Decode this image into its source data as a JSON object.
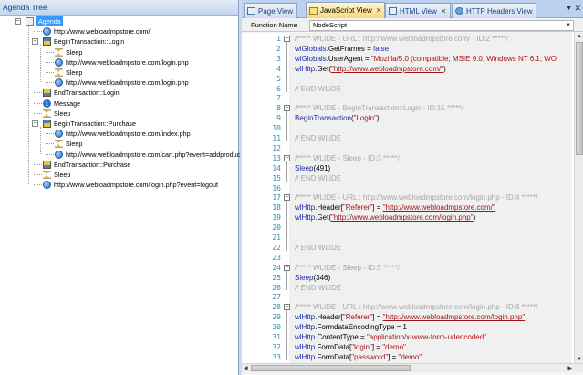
{
  "agenda_tree": {
    "title": "Agenda Tree",
    "items": [
      {
        "label": "Agenda",
        "icon": "agenda-icon",
        "level": 0,
        "selected": true
      },
      {
        "label": "http://www.webloadmpstore.com/",
        "icon": "globe-icon",
        "level": 1
      },
      {
        "label": "BeginTransaction::Login",
        "icon": "begin-transaction-icon",
        "level": 1
      },
      {
        "label": "Sleep",
        "icon": "hourglass-icon",
        "level": 2
      },
      {
        "label": "http://www.webloadmpstore.com/login.php",
        "icon": "globe-icon",
        "level": 2
      },
      {
        "label": "Sleep",
        "icon": "hourglass-icon",
        "level": 2
      },
      {
        "label": "http://www.webloadmpstore.com/login.php",
        "icon": "globe-icon",
        "level": 2
      },
      {
        "label": "EndTransaction::Login",
        "icon": "end-transaction-icon",
        "level": 1
      },
      {
        "label": "Message",
        "icon": "info-icon",
        "level": 1
      },
      {
        "label": "Sleep",
        "icon": "hourglass-icon",
        "level": 1
      },
      {
        "label": "BeginTransaction::Purchase",
        "icon": "begin-transaction-icon",
        "level": 1
      },
      {
        "label": "http://www.webloadmpstore.com/index.php",
        "icon": "globe-icon",
        "level": 2
      },
      {
        "label": "Sleep",
        "icon": "hourglass-icon",
        "level": 2
      },
      {
        "label": "http://www.webloadmpstore.com/cart.php?event=addproduc",
        "icon": "globe-icon",
        "level": 2
      },
      {
        "label": "EndTransaction::Purchase",
        "icon": "end-transaction-icon",
        "level": 1
      },
      {
        "label": "Sleep",
        "icon": "hourglass-icon",
        "level": 1
      },
      {
        "label": "http://www.webloadmpstore.com/login.php?event=logout",
        "icon": "globe-icon",
        "level": 1
      }
    ]
  },
  "tabs": [
    {
      "label": "Page View",
      "active": false
    },
    {
      "label": "JavaScript View",
      "active": true
    },
    {
      "label": "HTML View",
      "active": false
    },
    {
      "label": "HTTP Headers View",
      "active": false
    }
  ],
  "function_bar": {
    "label": "Function Name",
    "value": "NodeScript"
  },
  "editor": {
    "lines": [
      {
        "n": "1",
        "fold": "-",
        "parts": [
          {
            "t": "/***** WLIDE - URL : http://www.webloadmpstore.com/ - ID:2 *****/",
            "c": "comment"
          }
        ]
      },
      {
        "n": "2",
        "parts": [
          {
            "t": "wlGlobals",
            "c": "obj"
          },
          {
            "t": ".GetFrames = ",
            "c": ""
          },
          {
            "t": "false",
            "c": "kw"
          }
        ]
      },
      {
        "n": "3",
        "parts": [
          {
            "t": "wlGlobals",
            "c": "obj"
          },
          {
            "t": ".UserAgent = ",
            "c": ""
          },
          {
            "t": "\"Mozilla/5.0 (compatible; MSIE 9.0; Windows NT 6.1; WO",
            "c": "strn"
          }
        ]
      },
      {
        "n": "4",
        "parts": [
          {
            "t": "wlHttp",
            "c": "obj"
          },
          {
            "t": ".Get(",
            "c": ""
          },
          {
            "t": "\"http://www.webloadmpstore.com/\"",
            "c": "str"
          },
          {
            "t": ")",
            "c": ""
          }
        ]
      },
      {
        "n": "5",
        "parts": []
      },
      {
        "n": "6",
        "parts": [
          {
            "t": "// END WLIDE",
            "c": "comment"
          }
        ]
      },
      {
        "n": "7",
        "parts": []
      },
      {
        "n": "8",
        "fold": "-",
        "parts": [
          {
            "t": "/***** WLIDE - BeginTransaction::Login - ID:15 *****/",
            "c": "comment"
          }
        ]
      },
      {
        "n": "9",
        "parts": [
          {
            "t": "BeginTransaction",
            "c": "obj"
          },
          {
            "t": "(",
            "c": ""
          },
          {
            "t": "\"Login\"",
            "c": "strn"
          },
          {
            "t": ")",
            "c": ""
          }
        ]
      },
      {
        "n": "10",
        "parts": []
      },
      {
        "n": "11",
        "parts": [
          {
            "t": "// END WLIDE",
            "c": "comment"
          }
        ]
      },
      {
        "n": "12",
        "parts": []
      },
      {
        "n": "13",
        "fold": "-",
        "parts": [
          {
            "t": "/***** WLIDE - Sleep - ID:3 *****/",
            "c": "comment"
          }
        ]
      },
      {
        "n": "14",
        "parts": [
          {
            "t": "Sleep",
            "c": "obj"
          },
          {
            "t": "(491)",
            "c": ""
          }
        ]
      },
      {
        "n": "15",
        "parts": [
          {
            "t": "// END WLIDE",
            "c": "comment"
          }
        ]
      },
      {
        "n": "16",
        "parts": []
      },
      {
        "n": "17",
        "fold": "-",
        "parts": [
          {
            "t": "/***** WLIDE - URL : http://www.webloadmpstore.com/login.php - ID:4 *****/",
            "c": "comment"
          }
        ]
      },
      {
        "n": "18",
        "parts": [
          {
            "t": "wlHttp",
            "c": "obj"
          },
          {
            "t": ".Header[",
            "c": ""
          },
          {
            "t": "\"Referer\"",
            "c": "strn"
          },
          {
            "t": "] = ",
            "c": ""
          },
          {
            "t": "\"http://www.webloadmpstore.com/\"",
            "c": "str"
          }
        ]
      },
      {
        "n": "19",
        "parts": [
          {
            "t": "wlHttp",
            "c": "obj"
          },
          {
            "t": ".Get(",
            "c": ""
          },
          {
            "t": "\"http://www.webloadmpstore.com/login.php\"",
            "c": "str"
          },
          {
            "t": ")",
            "c": ""
          }
        ]
      },
      {
        "n": "20",
        "parts": []
      },
      {
        "n": "21",
        "parts": []
      },
      {
        "n": "22",
        "parts": [
          {
            "t": "// END WLIDE",
            "c": "comment"
          }
        ]
      },
      {
        "n": "23",
        "parts": []
      },
      {
        "n": "24",
        "fold": "-",
        "parts": [
          {
            "t": "/***** WLIDE - Sleep - ID:5 *****/",
            "c": "comment"
          }
        ]
      },
      {
        "n": "25",
        "parts": [
          {
            "t": "Sleep",
            "c": "obj"
          },
          {
            "t": "(346)",
            "c": ""
          }
        ]
      },
      {
        "n": "26",
        "parts": [
          {
            "t": "// END WLIDE",
            "c": "comment"
          }
        ]
      },
      {
        "n": "27",
        "parts": []
      },
      {
        "n": "28",
        "fold": "-",
        "parts": [
          {
            "t": "/***** WLIDE - URL : http://www.webloadmpstore.com/login.php - ID:6 *****/",
            "c": "comment"
          }
        ]
      },
      {
        "n": "29",
        "parts": [
          {
            "t": "wlHttp",
            "c": "obj"
          },
          {
            "t": ".Header[",
            "c": ""
          },
          {
            "t": "\"Referer\"",
            "c": "strn"
          },
          {
            "t": "] = ",
            "c": ""
          },
          {
            "t": "\"http://www.webloadmpstore.com/login.php\"",
            "c": "str"
          }
        ]
      },
      {
        "n": "30",
        "parts": [
          {
            "t": "wlHttp",
            "c": "obj"
          },
          {
            "t": ".FormdataEncodingType = 1",
            "c": ""
          }
        ]
      },
      {
        "n": "31",
        "parts": [
          {
            "t": "wlHttp",
            "c": "obj"
          },
          {
            "t": ".ContentType = ",
            "c": ""
          },
          {
            "t": "\"application/x-www-form-urlencoded\"",
            "c": "strn"
          }
        ]
      },
      {
        "n": "32",
        "parts": [
          {
            "t": "wlHttp",
            "c": "obj"
          },
          {
            "t": ".FormData[",
            "c": ""
          },
          {
            "t": "\"login\"",
            "c": "strn"
          },
          {
            "t": "] = ",
            "c": ""
          },
          {
            "t": "\"demo\"",
            "c": "strn"
          }
        ]
      },
      {
        "n": "33",
        "parts": [
          {
            "t": "wlHttp",
            "c": "obj"
          },
          {
            "t": ".FormData[",
            "c": ""
          },
          {
            "t": "\"password\"",
            "c": "strn"
          },
          {
            "t": "] = ",
            "c": ""
          },
          {
            "t": "\"demo\"",
            "c": "strn"
          }
        ]
      }
    ]
  }
}
